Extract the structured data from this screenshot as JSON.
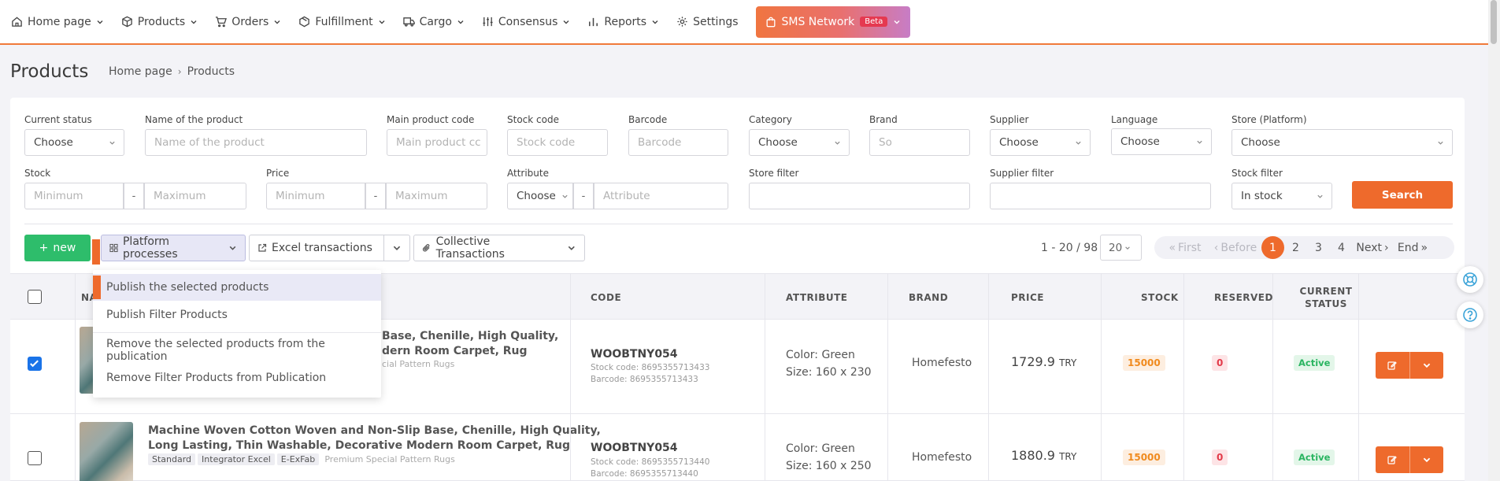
{
  "nav": {
    "items": [
      {
        "label": "Home page",
        "icon": "home-icon"
      },
      {
        "label": "Products",
        "icon": "box-icon"
      },
      {
        "label": "Orders",
        "icon": "cart-icon"
      },
      {
        "label": "Fulfillment",
        "icon": "package-icon"
      },
      {
        "label": "Cargo",
        "icon": "truck-icon"
      },
      {
        "label": "Consensus",
        "icon": "sliders-icon"
      },
      {
        "label": "Reports",
        "icon": "bar-chart-icon"
      },
      {
        "label": "Settings",
        "icon": "gear-icon"
      }
    ],
    "sms": {
      "label": "SMS Network",
      "badge": "Beta"
    }
  },
  "page": {
    "title": "Products",
    "breadcrumb": [
      "Home page",
      "Products"
    ],
    "accent": "#ee6a2c"
  },
  "filters": {
    "current_status": {
      "label": "Current status",
      "value": "Choose"
    },
    "product_name": {
      "label": "Name of the product",
      "placeholder": "Name of the product"
    },
    "main_code": {
      "label": "Main product code",
      "placeholder": "Main product cc"
    },
    "stock_code": {
      "label": "Stock code",
      "placeholder": "Stock code"
    },
    "barcode": {
      "label": "Barcode",
      "placeholder": "Barcode"
    },
    "category": {
      "label": "Category",
      "value": "Choose"
    },
    "brand": {
      "label": "Brand",
      "placeholder": "So"
    },
    "supplier": {
      "label": "Supplier",
      "value": "Choose"
    },
    "language": {
      "label": "Language",
      "value": "Choose"
    },
    "store": {
      "label": "Store (Platform)",
      "value": "Choose"
    },
    "stock": {
      "label": "Stock",
      "min": "Minimum",
      "max": "Maximum",
      "dash": "-"
    },
    "price": {
      "label": "Price",
      "min": "Minimum",
      "max": "Maximum",
      "dash": "-"
    },
    "attribute": {
      "label": "Attribute",
      "select": "Choose",
      "placeholder": "Attribute",
      "dash": "-"
    },
    "store_filter": {
      "label": "Store filter",
      "value": ""
    },
    "supplier_filter": {
      "label": "Supplier filter",
      "value": ""
    },
    "stock_filter": {
      "label": "Stock filter",
      "value": "In stock"
    },
    "search_label": "Search"
  },
  "actions": {
    "new_label": "new",
    "platform_label": "Platform processes",
    "excel_label": "Excel transactions",
    "collective_label": "Collective Transactions"
  },
  "pagination": {
    "info": "1 - 20 / 98",
    "per_page": "20",
    "first": "First",
    "before": "Before",
    "pages": [
      "1",
      "2",
      "3",
      "4"
    ],
    "current": "1",
    "next": "Next",
    "end": "End"
  },
  "menu": {
    "items": [
      "Publish the selected products",
      "Publish Filter Products",
      "Remove the selected products from the publication",
      "Remove Filter Products from Publication"
    ]
  },
  "table": {
    "headers": {
      "name": "NA",
      "code": "CODE",
      "attribute": "ATTRIBUTE",
      "brand": "BRAND",
      "price": "PRICE",
      "stock": "STOCK",
      "reserved": "RESERVED",
      "status_line1": "CURRENT",
      "status_line2": "STATUS"
    },
    "rows": [
      {
        "checked": true,
        "name_line1": "Base, Chenille, High Quality,",
        "name_line2": "dern Room Carpet, Rug",
        "subtext": "cial Pattern Rugs",
        "code": "WOOBTNY054",
        "stock_code": "Stock code: 8695355713433",
        "barcode": "Barcode: 8695355713433",
        "attr_color": "Color: Green",
        "attr_size": "Size: 160 x 230",
        "brand": "Homefesto",
        "price": "1729.9",
        "currency": "TRY",
        "stock": "15000",
        "reserved": "0",
        "status": "Active"
      },
      {
        "checked": false,
        "name_line1": "Machine Woven Cotton Woven and Non-Slip Base, Chenille, High Quality,",
        "name_line2": "Long Lasting, Thin Washable, Decorative Modern Room Carpet, Rug",
        "tags": [
          "Standard",
          "Integrator Excel",
          "E-ExFab"
        ],
        "subtext": "Premium Special Pattern Rugs",
        "code": "WOOBTNY054",
        "stock_code": "Stock code: 8695355713440",
        "barcode": "Barcode: 8695355713440",
        "attr_color": "Color: Green",
        "attr_size": "Size: 160 x 250",
        "brand": "Homefesto",
        "price": "1880.9",
        "currency": "TRY",
        "stock": "15000",
        "reserved": "0",
        "status": "Active"
      }
    ]
  }
}
